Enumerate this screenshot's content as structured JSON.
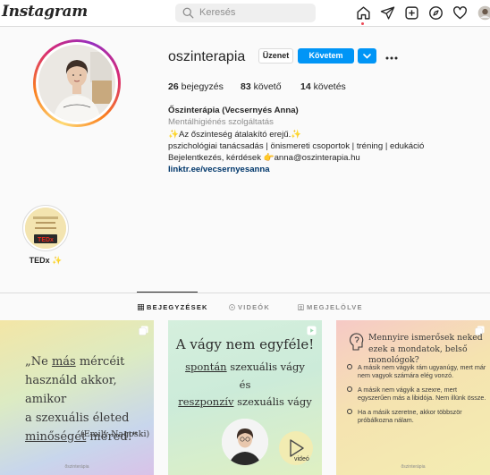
{
  "nav": {
    "logo": "Instagram",
    "search_placeholder": "Keresés",
    "icons": [
      "home-icon",
      "direct-icon",
      "new-post-icon",
      "explore-icon",
      "activity-icon",
      "profile-avatar"
    ]
  },
  "profile": {
    "username": "oszinterapia",
    "message_button": "Üzenet",
    "follow_button": "Követem",
    "stats": {
      "posts_count": "26",
      "posts_label": "bejegyzés",
      "followers_count": "83",
      "followers_label": "követő",
      "following_count": "14",
      "following_label": "követés"
    },
    "bio": {
      "name": "Őszinterápia (Vecsernyés Anna)",
      "category": "Mentálhigiénés szolgáltatás",
      "line1": "✨Az őszinteség átalakító erejű.✨",
      "line2": "pszichológiai tanácsadás | önismereti csoportok | tréning | edukáció",
      "line3": "Bejelentkezés, kérdések 👉anna@oszinterapia.hu",
      "link": "linktr.ee/vecsernyesanna"
    }
  },
  "highlights": [
    {
      "label": "TEDx ✨",
      "image_text": "TEDx"
    }
  ],
  "tabs": [
    {
      "label": "BEJEGYZÉSEK",
      "icon": "grid-icon",
      "active": true
    },
    {
      "label": "VIDEÓK",
      "icon": "video-icon",
      "active": false
    },
    {
      "label": "MEGJELÖLVE",
      "icon": "tagged-icon",
      "active": false
    }
  ],
  "posts": {
    "p1": {
      "line1_a": "„Ne ",
      "line1_u": "más",
      "line1_b": " mércéit",
      "line2": "használd akkor, amikor",
      "line3": "a szexuális életed",
      "line4_u": "minőségét",
      "line4_b": " méred!\"",
      "author": "(Emily Nagoski)",
      "brand": "őszinterápia"
    },
    "p2": {
      "title": "A vágy nem egyféle!",
      "s1_u": "spontán",
      "s1_b": " szexuális vágy",
      "s2": "és",
      "s3_u": "reszponzív",
      "s3_b": " szexuális vágy",
      "video_label": "videó"
    },
    "p3": {
      "question": "Mennyire ismerősek neked ezek a mondatok, belső monológok?",
      "items": [
        "A másik nem vágyik rám ugyanúgy, mert már nem vagyok számára elég vonzó.",
        "A másik nem vágyik a szexre, mert egyszerűen más a libidója. Nem illünk össze.",
        "Ha a másik szeretne, akkor többször próbálkozna nálam."
      ],
      "brand": "őszinterápia"
    }
  },
  "colors": {
    "accent": "#0095f6",
    "link": "#00376b",
    "notification": "#ed4956"
  }
}
